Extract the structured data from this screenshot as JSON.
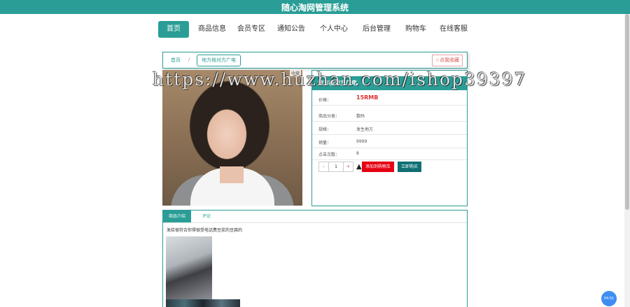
{
  "app": {
    "title": "随心淘网管理系统"
  },
  "nav": {
    "items": [
      {
        "label": "首页",
        "active": true
      },
      {
        "label": "商品信息"
      },
      {
        "label": "会员专区"
      },
      {
        "label": "通知公告"
      },
      {
        "label": "个人中心"
      },
      {
        "label": "后台管理"
      },
      {
        "label": "购物车"
      },
      {
        "label": "在线客服"
      }
    ]
  },
  "breadcrumb": {
    "home": "首页",
    "separator": "/",
    "current": "地方格对方广电",
    "favorite": "☆点我收藏"
  },
  "photo": {
    "fav_mini": "收藏"
  },
  "product": {
    "name": "地方格对方广电",
    "rows": [
      {
        "label": "价格：",
        "value": "15RMB"
      },
      {
        "label": "商品分类：",
        "value": "数码"
      },
      {
        "label": "规格：",
        "value": "发生地方"
      },
      {
        "label": "销量：",
        "value": "9999"
      },
      {
        "label": "点击次数：",
        "value": "8"
      }
    ],
    "quantity": {
      "minus": "-",
      "value": "1",
      "plus": "+"
    },
    "add_to_cart": "添加到购物车",
    "buy_now": "立即购买"
  },
  "details": {
    "tabs": [
      "商品介绍",
      "评论"
    ],
    "description": "发给很符合你得很受电话费豆浆的豆腐的"
  },
  "watermark": "https://www.huzhan.com/ishop39397",
  "clock": "04:51",
  "colors": {
    "primary": "#2a9d96",
    "danger": "#e60012",
    "dark_teal": "#0f6f74"
  }
}
